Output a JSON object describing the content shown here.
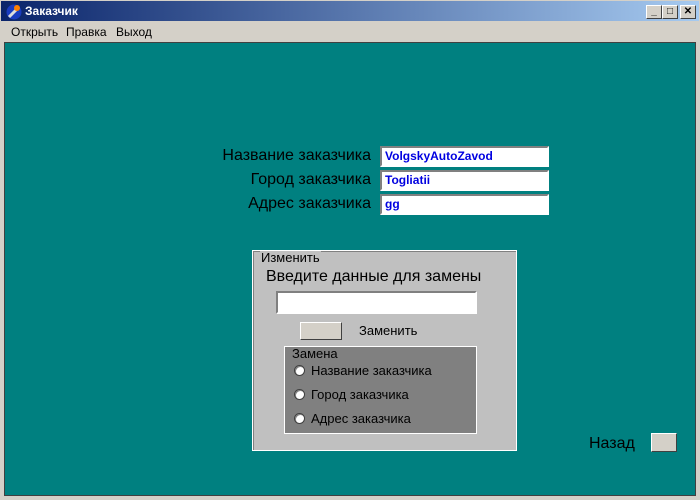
{
  "window": {
    "title": "Заказчик",
    "controls": {
      "minimize": "_",
      "maximize": "□",
      "close": "✕"
    }
  },
  "menu": [
    "Открыть",
    "Правка",
    "Выход"
  ],
  "form": {
    "name_label": "Название заказчика",
    "name_value": "VolgskyAutoZavod",
    "city_label": "Город заказчика",
    "city_value": "Togliatii",
    "address_label": "Адрес заказчика",
    "address_value": "gg"
  },
  "change_group": {
    "legend": "Изменить",
    "prompt": "Введите данные для замены",
    "input_value": "",
    "replace_label": "Заменить",
    "replace_group": {
      "legend": "Замена",
      "options": [
        "Название заказчика",
        "Город заказчика",
        "Адрес заказчика"
      ]
    }
  },
  "back_label": "Назад"
}
